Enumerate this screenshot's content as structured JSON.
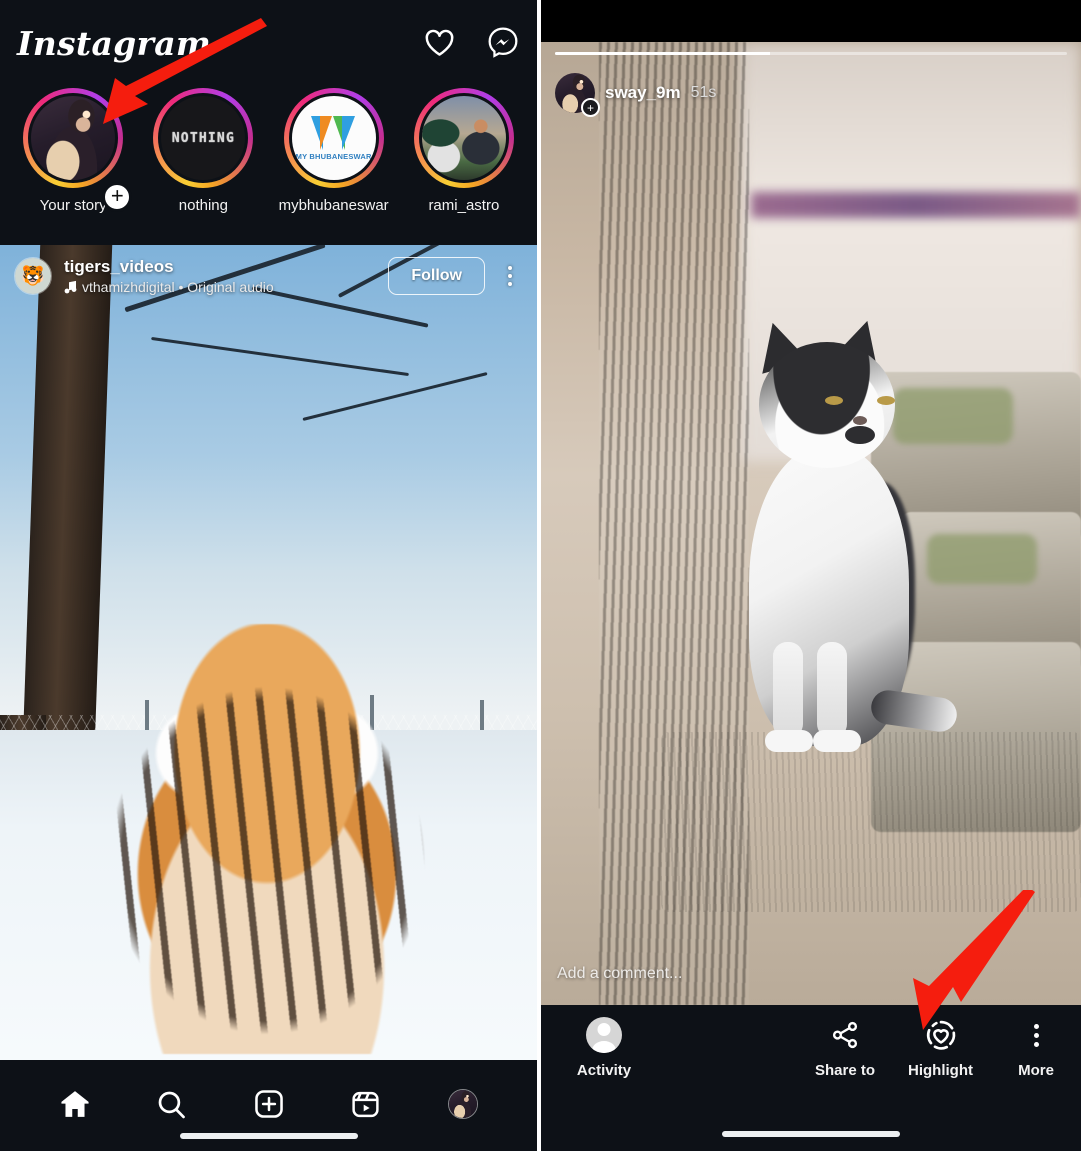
{
  "app": {
    "name": "Instagram"
  },
  "left_panel": {
    "header": {
      "logo_text": "Instagram",
      "icons": [
        {
          "name": "notifications-heart-icon",
          "label": "Notifications"
        },
        {
          "name": "messenger-icon",
          "label": "Messenger"
        }
      ]
    },
    "stories": [
      {
        "username": "Your story",
        "has_add_badge": true,
        "ring": "gradient",
        "avatar": "selfie",
        "add_badge_glyph": "+"
      },
      {
        "username": "nothing",
        "has_add_badge": false,
        "ring": "gradient",
        "avatar": "nothing-logo",
        "avatar_text": "NOTHING"
      },
      {
        "username": "mybhubaneswar",
        "has_add_badge": false,
        "ring": "gradient",
        "avatar": "mybhubaneswar-logo",
        "avatar_text": "MY BHUBANESWAR"
      },
      {
        "username": "rami_astro",
        "has_add_badge": false,
        "ring": "gradient",
        "avatar": "photo"
      }
    ],
    "post": {
      "username": "tigers_videos",
      "audio_text": "vthamizhdigital • Original audio",
      "audio_icon": "music-note-icon",
      "follow_label": "Follow",
      "more_icon": "kebab-menu-icon",
      "avatar_glyph": "🐯"
    },
    "bottom_nav": [
      {
        "name": "home",
        "icon": "home-icon",
        "active": true
      },
      {
        "name": "search",
        "icon": "search-icon",
        "active": false
      },
      {
        "name": "create",
        "icon": "plus-square-icon",
        "active": false
      },
      {
        "name": "reels",
        "icon": "reels-icon",
        "active": false
      },
      {
        "name": "profile",
        "icon": "profile-avatar-icon",
        "active": false
      }
    ]
  },
  "right_panel": {
    "story": {
      "username": "sway_9m",
      "timestamp": "51s",
      "progress_percent": 42,
      "add_badge_glyph": "+",
      "comment_placeholder": "Add a comment..."
    },
    "action_bar": {
      "activity": {
        "label": "Activity",
        "icon": "activity-avatar-icon"
      },
      "actions": [
        {
          "label": "Share to",
          "icon": "share-icon"
        },
        {
          "label": "Highlight",
          "icon": "highlight-heart-icon"
        },
        {
          "label": "More",
          "icon": "kebab-menu-icon"
        }
      ]
    }
  },
  "annotations": [
    {
      "name": "arrow-to-your-story",
      "color": "#f51d0e",
      "points_to": "Your story"
    },
    {
      "name": "arrow-to-highlight",
      "color": "#f51d0e",
      "points_to": "Highlight"
    }
  ],
  "colors": {
    "background": "#0d1117",
    "accent_arrow": "#f51d0e",
    "text_primary": "#ffffff",
    "ring_start": "#f9ce34",
    "ring_mid": "#ee2a7b",
    "ring_end": "#b13ee8"
  }
}
